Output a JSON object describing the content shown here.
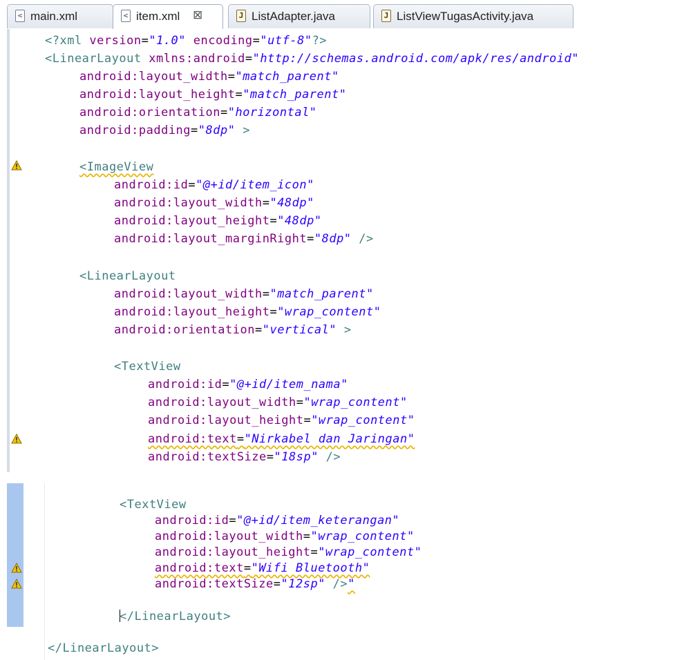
{
  "tabs": [
    {
      "label": "main.xml",
      "icon": "xml-file-icon"
    },
    {
      "label": "item.xml",
      "icon": "xml-file-icon",
      "active": true,
      "close": "⊠"
    },
    {
      "label": "ListAdapter.java",
      "icon": "java-file-icon"
    },
    {
      "label": "ListViewTugasActivity.java",
      "icon": "java-file-icon"
    }
  ],
  "code": {
    "l1": {
      "a": "<?xml ",
      "b": "version",
      "c": "=",
      "d": "\"1.0\"",
      "e": " ",
      "f": "encoding",
      "g": "=",
      "h": "\"utf-8\"",
      "i": "?>"
    },
    "l2": {
      "a": "<LinearLayout ",
      "b": "xmlns:android",
      "c": "=",
      "d": "\"http://schemas.android.com/apk/res/android\""
    },
    "l3": {
      "b": "android:layout_width",
      "c": "=",
      "d": "\"match_parent\""
    },
    "l4": {
      "b": "android:layout_height",
      "c": "=",
      "d": "\"match_parent\""
    },
    "l5": {
      "b": "android:orientation",
      "c": "=",
      "d": "\"horizontal\""
    },
    "l6": {
      "b": "android:padding",
      "c": "=",
      "d": "\"8dp\"",
      "e": " >"
    },
    "l7": {
      "a": "<ImageView"
    },
    "l8": {
      "b": "android:id",
      "c": "=",
      "d": "\"@+id/item_icon\""
    },
    "l9": {
      "b": "android:layout_width",
      "c": "=",
      "d": "\"48dp\""
    },
    "l10": {
      "b": "android:layout_height",
      "c": "=",
      "d": "\"48dp\""
    },
    "l11": {
      "b": "android:layout_marginRight",
      "c": "=",
      "d": "\"8dp\"",
      "e": " />"
    },
    "l12": {
      "a": "<LinearLayout"
    },
    "l13": {
      "b": "android:layout_width",
      "c": "=",
      "d": "\"match_parent\""
    },
    "l14": {
      "b": "android:layout_height",
      "c": "=",
      "d": "\"wrap_content\""
    },
    "l15": {
      "b": "android:orientation",
      "c": "=",
      "d": "\"vertical\"",
      "e": " >"
    },
    "l16": {
      "a": "<TextView"
    },
    "l17": {
      "b": "android:id",
      "c": "=",
      "d": "\"@+id/item_nama\""
    },
    "l18": {
      "b": "android:layout_width",
      "c": "=",
      "d": "\"wrap_content\""
    },
    "l19": {
      "b": "android:layout_height",
      "c": "=",
      "d": "\"wrap_content\""
    },
    "l20": {
      "b": "android:text",
      "c": "=",
      "d": "\"Nirkabel dan Jaringan\""
    },
    "l21": {
      "b": "android:textSize",
      "c": "=",
      "d": "\"18sp\"",
      "e": " />"
    },
    "l22": {
      "a": "<TextView"
    },
    "l23": {
      "b": "android:id",
      "c": "=",
      "d": "\"@+id/item_keterangan\""
    },
    "l24": {
      "b": "android:layout_width",
      "c": "=",
      "d": "\"wrap_content\""
    },
    "l25": {
      "b": "android:layout_height",
      "c": "=",
      "d": "\"wrap_content\""
    },
    "l26": {
      "b": "android:text",
      "c": "=",
      "d": "\"Wifi Bluetooth\""
    },
    "l27": {
      "b": "android:textSize",
      "c": "=",
      "d": "\"12sp\"",
      "e": " />",
      "f": "\""
    },
    "l28": {
      "a": "</LinearLayout>"
    },
    "l29": {
      "a": "</LinearLayout>"
    }
  },
  "colors": {
    "tag": "#3f7f7f",
    "attribute": "#7f007f",
    "value": "#2a00ff",
    "warning": "#e8b400"
  },
  "gutter_icons": [
    "warning-icon"
  ]
}
